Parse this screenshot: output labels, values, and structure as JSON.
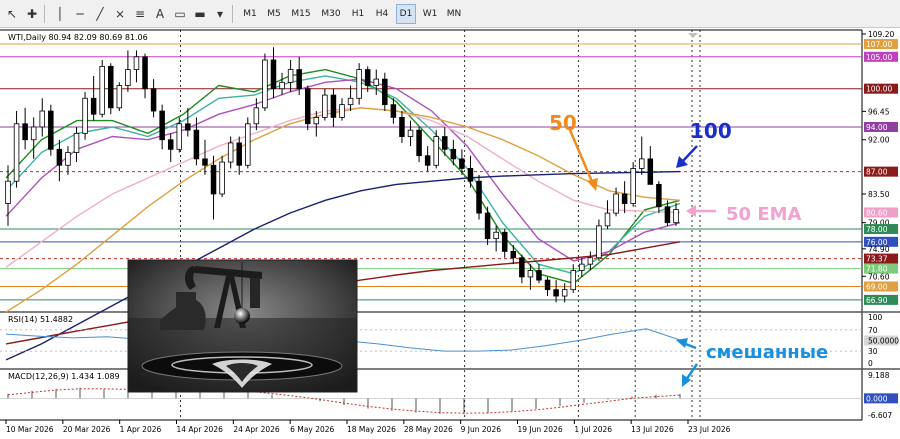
{
  "toolbar": {
    "timeframes": [
      "M1",
      "M5",
      "M15",
      "M30",
      "H1",
      "H4",
      "D1",
      "W1",
      "MN"
    ],
    "active_timeframe": "D1",
    "tools": [
      "cursor-icon",
      "crosshair-icon",
      "vertical-line-icon",
      "horizontal-line-icon",
      "trendline-icon",
      "channel-icon",
      "fibonacci-icon",
      "text-icon",
      "label-icon",
      "rectangle-icon",
      "shapes-icon"
    ]
  },
  "main": {
    "header_text": "WTI,Daily  80.94 82.09 80.69 81.06"
  },
  "rsi": {
    "header_text": "RSI(14) 51.4882"
  },
  "macd": {
    "header_text": "MACD(12,26,9) 1.434 1.089"
  },
  "annotations": {
    "label_50": "50",
    "label_100": "100",
    "label_50ema": "50 EMA",
    "label_mixed": "смешанные"
  },
  "colors": {
    "annotation_orange": "#f28b1d",
    "annotation_blue": "#1a2fc9",
    "annotation_pink": "#f2a1d0",
    "annotation_lightblue": "#1a8fe0"
  },
  "chart_data": [
    {
      "type": "candlestick",
      "symbol": "WTI",
      "timeframe": "Daily",
      "x": [
        "10 Mar 2026",
        "20 Mar 2026",
        "1 Apr 2026",
        "14 Apr 2026",
        "24 Apr 2026",
        "6 May 2026",
        "18 May 2026",
        "28 May 2026",
        "9 Jun 2026",
        "19 Jun 2026",
        "1 Jul 2026",
        "13 Jul 2026",
        "23 Jul 2026"
      ],
      "ylim": [
        65.0,
        109.2
      ],
      "right_axis_labels": [
        {
          "value": "109.20",
          "style": "plain"
        },
        {
          "value": "107.00",
          "style": "orange"
        },
        {
          "value": "105.00",
          "style": "magenta"
        },
        {
          "value": "100.00",
          "style": "darkred"
        },
        {
          "value": "96.45",
          "style": "plain"
        },
        {
          "value": "94.00",
          "style": "purple"
        },
        {
          "value": "92.00",
          "style": "plain"
        },
        {
          "value": "87.00",
          "style": "darkred"
        },
        {
          "value": "83.50",
          "style": "plain"
        },
        {
          "value": "80.60",
          "style": "pink"
        },
        {
          "value": "79.00",
          "style": "plain"
        },
        {
          "value": "78.00",
          "style": "green"
        },
        {
          "value": "76.00",
          "style": "blue"
        },
        {
          "value": "74.90",
          "style": "plain"
        },
        {
          "value": "73.37",
          "style": "darkred"
        },
        {
          "value": "71.80",
          "style": "lightgreen"
        },
        {
          "value": "70.60",
          "style": "plain"
        },
        {
          "value": "69.00",
          "style": "orange"
        },
        {
          "value": "66.90",
          "style": "green"
        }
      ],
      "horizontal_levels": [
        {
          "value": 107.0,
          "color": "#d9a441"
        },
        {
          "value": 105.0,
          "color": "#c040c0"
        },
        {
          "value": 100.0,
          "color": "#8b1a1a"
        },
        {
          "value": 94.0,
          "color": "#9040a0"
        },
        {
          "value": 87.0,
          "color": "#b03030",
          "dashed": true
        },
        {
          "value": 78.0,
          "color": "#2e8b57"
        },
        {
          "value": 76.0,
          "color": "#3050c0"
        },
        {
          "value": 73.37,
          "color": "#b03030",
          "dashed": true
        },
        {
          "value": 71.8,
          "color": "#7ccc7c"
        },
        {
          "value": 69.0,
          "color": "#e08020"
        },
        {
          "value": 66.9,
          "color": "#2e8b57"
        }
      ],
      "ohlc": [
        [
          82.0,
          88.0,
          78.5,
          85.5
        ],
        [
          85.5,
          96.5,
          84.5,
          94.5
        ],
        [
          94.5,
          97.0,
          90.5,
          92.0
        ],
        [
          92.0,
          95.5,
          89.0,
          94.0
        ],
        [
          94.0,
          98.5,
          92.5,
          96.5
        ],
        [
          96.5,
          97.5,
          89.5,
          90.5
        ],
        [
          90.5,
          92.0,
          85.5,
          88.0
        ],
        [
          88.0,
          91.0,
          86.5,
          90.0
        ],
        [
          90.0,
          94.0,
          88.5,
          93.0
        ],
        [
          93.0,
          99.5,
          92.0,
          98.5
        ],
        [
          98.5,
          102.0,
          95.0,
          96.0
        ],
        [
          96.0,
          104.5,
          95.5,
          103.5
        ],
        [
          103.5,
          104.0,
          96.0,
          97.0
        ],
        [
          97.0,
          101.0,
          96.5,
          100.5
        ],
        [
          100.5,
          106.0,
          99.5,
          103.0
        ],
        [
          103.0,
          106.0,
          101.0,
          105.0
        ],
        [
          105.0,
          105.5,
          98.5,
          100.0
        ],
        [
          100.0,
          101.5,
          95.5,
          96.5
        ],
        [
          96.5,
          97.5,
          90.5,
          92.0
        ],
        [
          92.0,
          93.0,
          88.5,
          90.5
        ],
        [
          90.5,
          95.5,
          90.0,
          94.5
        ],
        [
          94.5,
          97.0,
          92.5,
          93.5
        ],
        [
          93.5,
          95.5,
          88.0,
          89.0
        ],
        [
          89.0,
          92.0,
          86.5,
          88.0
        ],
        [
          88.0,
          89.5,
          79.5,
          83.5
        ],
        [
          83.5,
          89.5,
          83.0,
          88.5
        ],
        [
          88.5,
          92.5,
          87.5,
          91.5
        ],
        [
          91.5,
          92.5,
          86.5,
          88.0
        ],
        [
          88.0,
          95.5,
          87.5,
          94.5
        ],
        [
          94.5,
          98.5,
          93.5,
          97.0
        ],
        [
          97.0,
          105.5,
          96.5,
          104.5
        ],
        [
          104.5,
          106.5,
          98.5,
          100.0
        ],
        [
          100.0,
          102.5,
          99.0,
          101.0
        ],
        [
          101.0,
          104.5,
          99.5,
          103.0
        ],
        [
          103.0,
          105.0,
          99.0,
          100.0
        ],
        [
          100.0,
          100.5,
          93.5,
          94.5
        ],
        [
          94.5,
          96.5,
          92.5,
          95.5
        ],
        [
          95.5,
          100.0,
          95.0,
          99.0
        ],
        [
          99.0,
          100.0,
          94.0,
          95.5
        ],
        [
          95.5,
          98.5,
          95.0,
          97.5
        ],
        [
          97.5,
          100.5,
          96.5,
          98.5
        ],
        [
          98.5,
          104.0,
          97.5,
          103.0
        ],
        [
          103.0,
          103.5,
          99.5,
          100.5
        ],
        [
          100.5,
          103.0,
          99.0,
          101.5
        ],
        [
          101.5,
          102.5,
          96.5,
          97.5
        ],
        [
          97.5,
          98.5,
          94.5,
          95.5
        ],
        [
          95.5,
          96.5,
          91.5,
          92.5
        ],
        [
          92.5,
          95.0,
          91.0,
          93.5
        ],
        [
          93.5,
          94.0,
          88.5,
          89.5
        ],
        [
          89.5,
          91.0,
          87.0,
          88.0
        ],
        [
          88.0,
          93.5,
          87.5,
          92.5
        ],
        [
          92.5,
          94.0,
          89.5,
          90.5
        ],
        [
          90.5,
          92.0,
          88.0,
          89.0
        ],
        [
          89.0,
          90.5,
          86.5,
          87.5
        ],
        [
          87.5,
          89.5,
          84.5,
          85.5
        ],
        [
          85.5,
          86.5,
          79.5,
          80.5
        ],
        [
          80.5,
          81.5,
          75.5,
          76.5
        ],
        [
          76.5,
          78.5,
          74.5,
          77.5
        ],
        [
          77.5,
          78.0,
          73.5,
          74.5
        ],
        [
          74.5,
          75.5,
          72.5,
          73.5
        ],
        [
          73.5,
          74.0,
          69.5,
          70.5
        ],
        [
          70.5,
          72.5,
          68.5,
          71.5
        ],
        [
          71.5,
          72.5,
          69.5,
          70.0
        ],
        [
          70.0,
          70.5,
          67.5,
          68.5
        ],
        [
          68.5,
          70.0,
          66.5,
          67.5
        ],
        [
          67.5,
          69.5,
          66.5,
          68.5
        ],
        [
          68.5,
          72.5,
          68.0,
          71.5
        ],
        [
          71.5,
          73.5,
          70.5,
          72.5
        ],
        [
          72.5,
          74.5,
          71.5,
          73.5
        ],
        [
          73.5,
          79.5,
          73.0,
          78.5
        ],
        [
          78.5,
          82.5,
          78.0,
          80.5
        ],
        [
          80.5,
          84.5,
          80.0,
          83.5
        ],
        [
          83.5,
          85.5,
          80.5,
          82.0
        ],
        [
          82.0,
          88.5,
          81.5,
          87.5
        ],
        [
          87.5,
          92.5,
          86.5,
          89.0
        ],
        [
          89.0,
          91.0,
          85.5,
          85.0
        ],
        [
          85.0,
          85.5,
          80.5,
          81.5
        ],
        [
          81.5,
          82.5,
          78.5,
          79.0
        ],
        [
          79.0,
          82.09,
          78.5,
          81.06
        ]
      ],
      "moving_averages": [
        {
          "name": "green-sma",
          "color": "#1e8c1e",
          "values": [
            86.0,
            92.0,
            95.0,
            95.0,
            93.0,
            96.0,
            100.5,
            99.5,
            102.0,
            103.0,
            101.5,
            98.0,
            92.0,
            86.0,
            77.0,
            71.0,
            69.5,
            74.0,
            81.0,
            82.5
          ]
        },
        {
          "name": "teal-sma",
          "color": "#3cb3a0",
          "values": [
            84.0,
            90.0,
            93.0,
            94.0,
            92.5,
            95.0,
            98.5,
            99.0,
            101.0,
            102.0,
            101.0,
            98.5,
            93.5,
            87.5,
            79.0,
            72.5,
            71.0,
            74.5,
            80.0,
            82.0
          ]
        },
        {
          "name": "purple-sma",
          "color": "#b050c0",
          "values": [
            80.0,
            86.0,
            90.5,
            92.5,
            92.0,
            93.5,
            96.0,
            97.5,
            99.5,
            101.0,
            101.5,
            100.0,
            96.5,
            91.0,
            83.5,
            76.5,
            73.0,
            74.5,
            77.5,
            79.0
          ]
        },
        {
          "name": "pink-ema50",
          "color": "#f0b0c8",
          "values": [
            72.0,
            76.0,
            80.0,
            83.5,
            86.0,
            88.5,
            91.0,
            93.0,
            95.0,
            96.5,
            97.0,
            96.5,
            95.0,
            92.5,
            89.0,
            85.5,
            82.5,
            81.0,
            80.8,
            80.6
          ]
        },
        {
          "name": "orange-sma50",
          "color": "#e0a040",
          "values": [
            65.0,
            68.5,
            72.5,
            77.0,
            81.5,
            85.5,
            89.0,
            92.0,
            94.5,
            96.0,
            97.0,
            96.5,
            95.5,
            94.0,
            92.0,
            89.5,
            86.5,
            84.0,
            83.0,
            82.5
          ]
        },
        {
          "name": "navy-sma100",
          "color": "#1a2070",
          "values": [
            57.5,
            60.0,
            63.0,
            66.0,
            69.0,
            72.0,
            75.0,
            78.0,
            80.5,
            82.5,
            84.0,
            85.0,
            85.5,
            86.0,
            86.3,
            86.5,
            86.7,
            86.8,
            86.9,
            87.0
          ]
        },
        {
          "name": "darkred-sma200",
          "color": "#8b1a1a",
          "values": [
            60.0,
            61.0,
            62.0,
            63.0,
            64.0,
            65.0,
            66.0,
            67.0,
            68.0,
            69.0,
            70.0,
            70.8,
            71.5,
            72.0,
            72.5,
            73.0,
            73.5,
            74.0,
            75.0,
            76.0
          ]
        }
      ]
    },
    {
      "type": "line",
      "name": "RSI(14)",
      "ylim": [
        0,
        100
      ],
      "tick_labels": [
        "100",
        "70",
        "50.0000",
        "30",
        "0"
      ],
      "levels": [
        70,
        30
      ],
      "values": [
        62,
        58,
        55,
        57,
        52,
        60,
        62,
        58,
        60,
        56,
        50,
        44,
        36,
        30,
        30,
        32,
        40,
        50,
        62,
        72,
        51
      ]
    },
    {
      "type": "bar",
      "name": "MACD(12,26,9)",
      "ylim": [
        -6.607,
        9.188
      ],
      "tick_labels": [
        "9.188",
        "0.000",
        "-6.607"
      ],
      "histogram": [
        1.5,
        2.5,
        3.2,
        3.5,
        3.0,
        2.8,
        3.2,
        3.6,
        3.4,
        2.8,
        2.0,
        1.2,
        0.2,
        -1.0,
        -2.3,
        -3.4,
        -4.2,
        -4.8,
        -5.2,
        -5.3,
        -5.0,
        -4.4,
        -3.6,
        -2.6,
        -1.5,
        -0.4,
        0.6,
        1.2,
        1.434
      ],
      "signal": [
        1.2,
        2.0,
        2.8,
        3.2,
        3.2,
        3.0,
        3.1,
        3.3,
        3.3,
        3.0,
        2.4,
        1.6,
        0.7,
        -0.4,
        -1.6,
        -2.7,
        -3.6,
        -4.3,
        -4.8,
        -5.0,
        -4.9,
        -4.5,
        -3.9,
        -3.0,
        -2.0,
        -1.0,
        0.0,
        0.6,
        1.089
      ]
    }
  ]
}
